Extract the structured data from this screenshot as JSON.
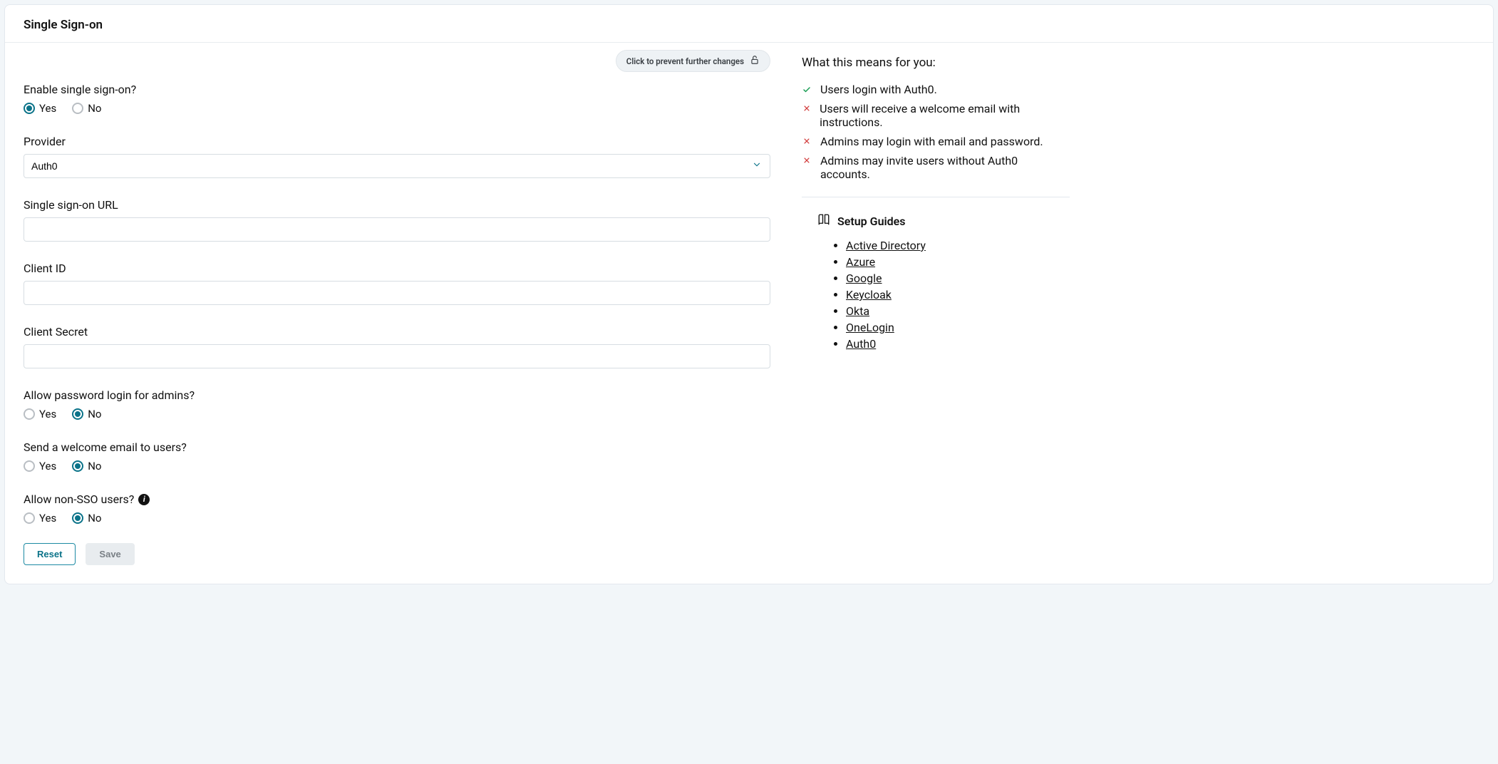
{
  "page": {
    "title": "Single Sign-on"
  },
  "lock_button": {
    "label": "Click to prevent further changes"
  },
  "form": {
    "enable_sso": {
      "label": "Enable single sign-on?",
      "yes": "Yes",
      "no": "No",
      "value": "yes"
    },
    "provider": {
      "label": "Provider",
      "value": "Auth0"
    },
    "sso_url": {
      "label": "Single sign-on URL",
      "value": ""
    },
    "client_id": {
      "label": "Client ID",
      "value": ""
    },
    "client_secret": {
      "label": "Client Secret",
      "value": ""
    },
    "admin_password_login": {
      "label": "Allow password login for admins?",
      "yes": "Yes",
      "no": "No",
      "value": "no"
    },
    "welcome_email": {
      "label": "Send a welcome email to users?",
      "yes": "Yes",
      "no": "No",
      "value": "no"
    },
    "allow_non_sso": {
      "label": "Allow non-SSO users?",
      "yes": "Yes",
      "no": "No",
      "value": "no"
    },
    "buttons": {
      "reset": "Reset",
      "save": "Save"
    }
  },
  "side": {
    "title": "What this means for you:",
    "impacts": [
      {
        "kind": "check",
        "text": "Users login with Auth0."
      },
      {
        "kind": "cross",
        "text": "Users will receive a welcome email with instructions."
      },
      {
        "kind": "cross",
        "text": "Admins may login with email and password."
      },
      {
        "kind": "cross",
        "text": "Admins may invite users without Auth0 accounts."
      }
    ],
    "guides_title": "Setup Guides",
    "guides": [
      "Active Directory",
      "Azure",
      "Google",
      "Keycloak",
      "Okta",
      "OneLogin",
      "Auth0"
    ]
  }
}
